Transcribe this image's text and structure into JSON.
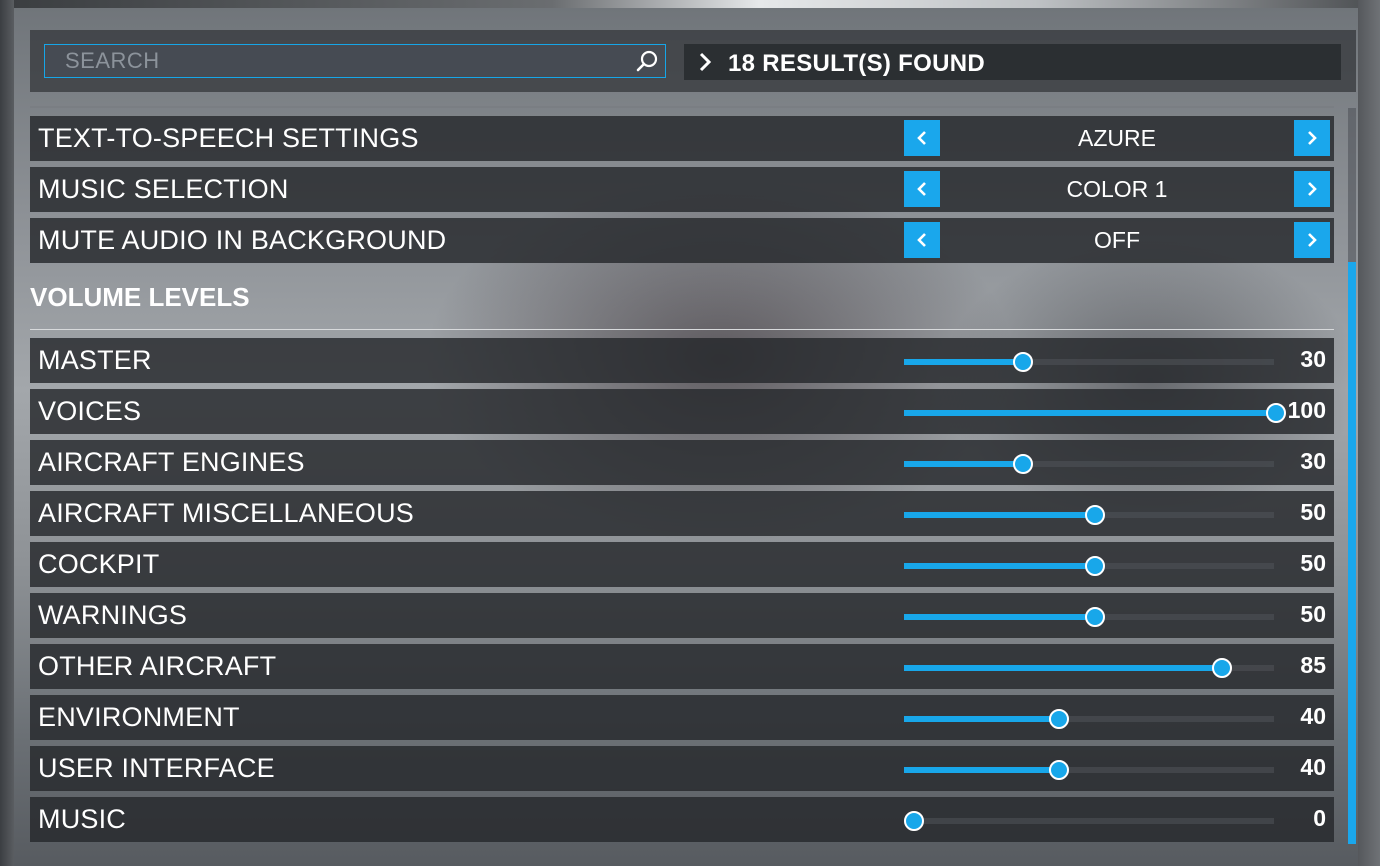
{
  "search": {
    "placeholder": "SEARCH",
    "value": ""
  },
  "results": {
    "label": "18 RESULT(S) FOUND"
  },
  "options": [
    {
      "label": "TEXT-TO-SPEECH SETTINGS",
      "value": "AZURE"
    },
    {
      "label": "MUSIC SELECTION",
      "value": "COLOR 1"
    },
    {
      "label": "MUTE AUDIO IN BACKGROUND",
      "value": "OFF"
    }
  ],
  "volume_section": {
    "title": "VOLUME LEVELS"
  },
  "sliders": [
    {
      "label": "MASTER",
      "value": "30",
      "level": 30
    },
    {
      "label": "VOICES",
      "value": "100",
      "level": 100
    },
    {
      "label": "AIRCRAFT ENGINES",
      "value": "30",
      "level": 30
    },
    {
      "label": "AIRCRAFT MISCELLANEOUS",
      "value": "50",
      "level": 50
    },
    {
      "label": "COCKPIT",
      "value": "50",
      "level": 50
    },
    {
      "label": "WARNINGS",
      "value": "50",
      "level": 50
    },
    {
      "label": "OTHER AIRCRAFT",
      "value": "85",
      "level": 85
    },
    {
      "label": "ENVIRONMENT",
      "value": "40",
      "level": 40
    },
    {
      "label": "USER INTERFACE",
      "value": "40",
      "level": 40
    },
    {
      "label": "MUSIC",
      "value": "0",
      "level": 0
    }
  ],
  "colors": {
    "accent": "#1aa7ec",
    "row_background": "#26282c",
    "text": "#ffffff"
  },
  "icons": {
    "search": "search-icon",
    "results": "chevron-right-icon",
    "previous": "chevron-left-icon",
    "next": "chevron-right-icon"
  }
}
